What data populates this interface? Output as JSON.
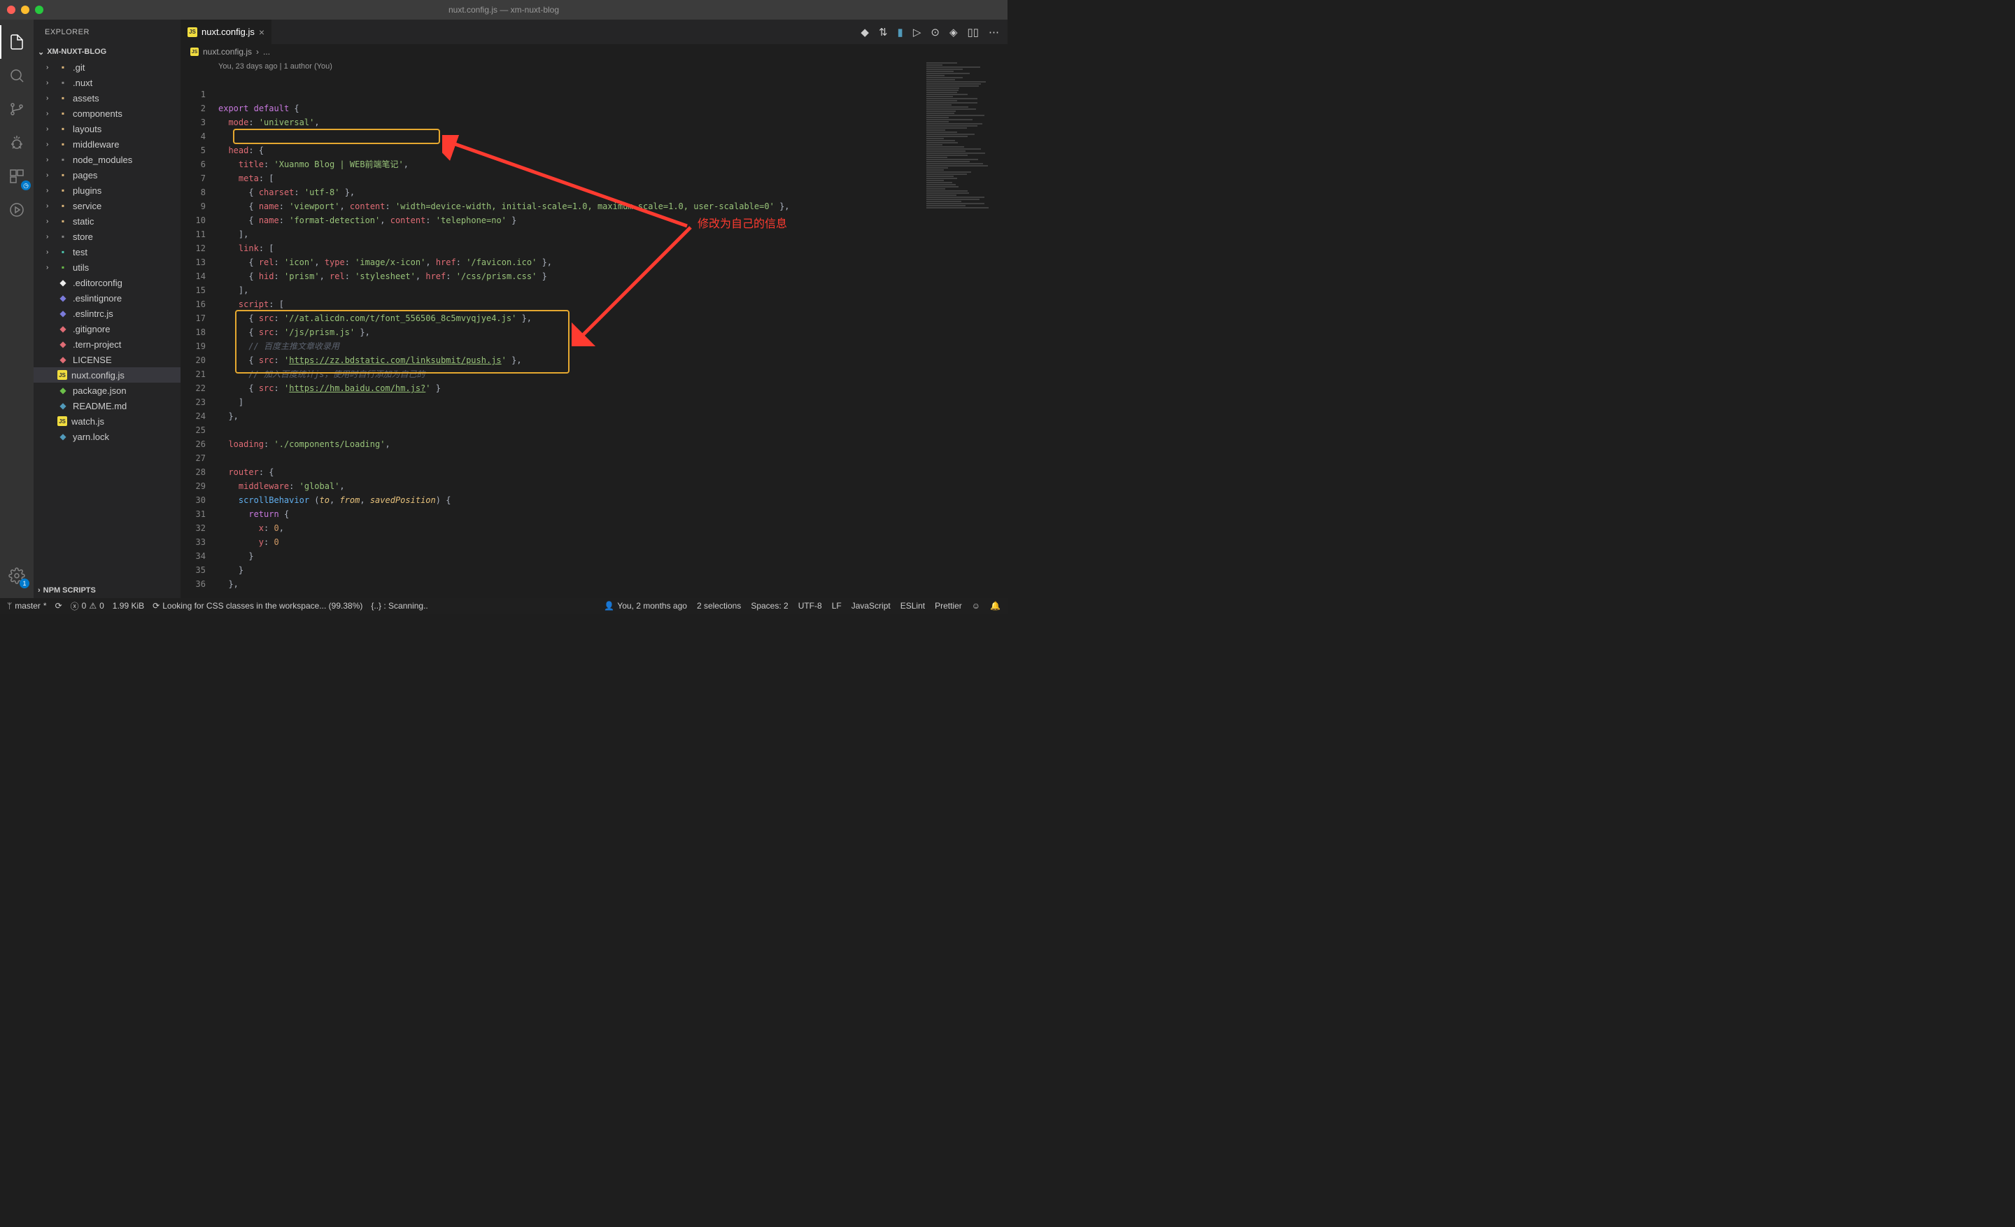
{
  "titlebar": {
    "title": "nuxt.config.js — xm-nuxt-blog"
  },
  "explorer": {
    "title": "EXPLORER",
    "project": "XM-NUXT-BLOG",
    "npm_scripts": "NPM SCRIPTS",
    "folders": [
      {
        "name": ".git",
        "type": "folder",
        "color": "folder-icon"
      },
      {
        "name": ".nuxt",
        "type": "folder",
        "color": "folder-icon grey"
      },
      {
        "name": "assets",
        "type": "folder",
        "color": "folder-icon"
      },
      {
        "name": "components",
        "type": "folder",
        "color": "folder-icon"
      },
      {
        "name": "layouts",
        "type": "folder",
        "color": "folder-icon"
      },
      {
        "name": "middleware",
        "type": "folder",
        "color": "folder-icon"
      },
      {
        "name": "node_modules",
        "type": "folder",
        "color": "folder-icon grey"
      },
      {
        "name": "pages",
        "type": "folder",
        "color": "folder-icon"
      },
      {
        "name": "plugins",
        "type": "folder",
        "color": "folder-icon"
      },
      {
        "name": "service",
        "type": "folder",
        "color": "folder-icon"
      },
      {
        "name": "static",
        "type": "folder",
        "color": "folder-icon"
      },
      {
        "name": "store",
        "type": "folder",
        "color": "folder-icon grey"
      },
      {
        "name": "test",
        "type": "folder",
        "color": "folder-icon teal"
      },
      {
        "name": "utils",
        "type": "folder",
        "color": "folder-icon green"
      }
    ],
    "files": [
      {
        "name": ".editorconfig",
        "iconcolor": "#eee"
      },
      {
        "name": ".eslintignore",
        "iconcolor": "#7b7bdb"
      },
      {
        "name": ".eslintrc.js",
        "iconcolor": "#7b7bdb"
      },
      {
        "name": ".gitignore",
        "iconcolor": "#e06c75"
      },
      {
        "name": ".tern-project",
        "iconcolor": "#e06c75"
      },
      {
        "name": "LICENSE",
        "iconcolor": "#e06c75"
      },
      {
        "name": "nuxt.config.js",
        "iconcolor": "js",
        "selected": true
      },
      {
        "name": "package.json",
        "iconcolor": "#6cc04a"
      },
      {
        "name": "README.md",
        "iconcolor": "#519aba"
      },
      {
        "name": "watch.js",
        "iconcolor": "js"
      },
      {
        "name": "yarn.lock",
        "iconcolor": "#519aba"
      }
    ]
  },
  "tab": {
    "label": "nuxt.config.js"
  },
  "breadcrumb": {
    "file": "nuxt.config.js",
    "more": "..."
  },
  "codelens": "You, 23 days ago | 1 author (You)",
  "code_lines": [
    "<span class='k-keyword'>export</span> <span class='k-keyword'>default</span> <span class='k-punc'>{</span>",
    "  <span class='k-prop'>mode</span><span class='k-punc'>:</span> <span class='k-string'>'universal'</span><span class='k-punc'>,</span>",
    "",
    "  <span class='k-prop'>head</span><span class='k-punc'>: {</span>",
    "    <span class='k-prop'>title</span><span class='k-punc'>:</span> <span class='k-string'>'Xuanmo Blog | WEB前端笔记'</span><span class='k-punc'>,</span>",
    "    <span class='k-prop'>meta</span><span class='k-punc'>: [</span>",
    "      <span class='k-punc'>{</span> <span class='k-prop'>charset</span><span class='k-punc'>:</span> <span class='k-string'>'utf-8'</span> <span class='k-punc'>},</span>",
    "      <span class='k-punc'>{</span> <span class='k-prop'>name</span><span class='k-punc'>:</span> <span class='k-string'>'viewport'</span><span class='k-punc'>,</span> <span class='k-prop'>content</span><span class='k-punc'>:</span> <span class='k-string'>'width=device-width, initial-scale=1.0, maximum-scale=1.0, user-scalable=0'</span> <span class='k-punc'>},</span>",
    "      <span class='k-punc'>{</span> <span class='k-prop'>name</span><span class='k-punc'>:</span> <span class='k-string'>'format-detection'</span><span class='k-punc'>,</span> <span class='k-prop'>content</span><span class='k-punc'>:</span> <span class='k-string'>'telephone=no'</span> <span class='k-punc'>}</span>",
    "    <span class='k-punc'>],</span>",
    "    <span class='k-prop'>link</span><span class='k-punc'>: [</span>",
    "      <span class='k-punc'>{</span> <span class='k-prop'>rel</span><span class='k-punc'>:</span> <span class='k-string'>'icon'</span><span class='k-punc'>,</span> <span class='k-prop'>type</span><span class='k-punc'>:</span> <span class='k-string'>'image/x-icon'</span><span class='k-punc'>,</span> <span class='k-prop'>href</span><span class='k-punc'>:</span> <span class='k-string'>'/favicon.ico'</span> <span class='k-punc'>},</span>",
    "      <span class='k-punc'>{</span> <span class='k-prop'>hid</span><span class='k-punc'>:</span> <span class='k-string'>'prism'</span><span class='k-punc'>,</span> <span class='k-prop'>rel</span><span class='k-punc'>:</span> <span class='k-string'>'stylesheet'</span><span class='k-punc'>,</span> <span class='k-prop'>href</span><span class='k-punc'>:</span> <span class='k-string'>'/css/prism.css'</span> <span class='k-punc'>}</span>",
    "    <span class='k-punc'>],</span>",
    "    <span class='k-prop'>script</span><span class='k-punc'>: [</span>",
    "      <span class='k-punc'>{</span> <span class='k-prop'>src</span><span class='k-punc'>:</span> <span class='k-string'>'//at.alicdn.com/t/font_556506_8c5mvyqjye4.js'</span> <span class='k-punc'>},</span>",
    "      <span class='k-punc'>{</span> <span class='k-prop'>src</span><span class='k-punc'>:</span> <span class='k-string'>'/js/prism.js'</span> <span class='k-punc'>},</span>",
    "      <span class='k-comment'>// 百度主推文章收录用</span>",
    "      <span class='k-punc'>{</span> <span class='k-prop'>src</span><span class='k-punc'>:</span> <span class='k-string'>'</span><span class='k-link'>https://zz.bdstatic.com/linksubmit/push.js</span><span class='k-string'>'</span> <span class='k-punc'>},</span>",
    "      <span class='k-comment'>// 加入百度统计js，使用时自行添加为自己的</span>",
    "      <span class='k-punc'>{</span> <span class='k-prop'>src</span><span class='k-punc'>:</span> <span class='k-string'>'</span><span class='k-link'>https://hm.baidu.com/hm.js?</span><span class='k-string'>'</span> <span class='k-punc'>}</span>",
    "    <span class='k-punc'>]</span>",
    "  <span class='k-punc'>},</span>",
    "",
    "  <span class='k-prop'>loading</span><span class='k-punc'>:</span> <span class='k-string'>'./components/Loading'</span><span class='k-punc'>,</span>",
    "",
    "  <span class='k-prop'>router</span><span class='k-punc'>: {</span>",
    "    <span class='k-prop'>middleware</span><span class='k-punc'>:</span> <span class='k-string'>'global'</span><span class='k-punc'>,</span>",
    "    <span class='k-func'>scrollBehavior</span> <span class='k-punc'>(</span><span class='k-param'>to</span><span class='k-punc'>,</span> <span class='k-param'>from</span><span class='k-punc'>,</span> <span class='k-param'>savedPosition</span><span class='k-punc'>) {</span>",
    "      <span class='k-keyword'>return</span> <span class='k-punc'>{</span>",
    "        <span class='k-prop'>x</span><span class='k-punc'>:</span> <span class='k-num'>0</span><span class='k-punc'>,</span>",
    "        <span class='k-prop'>y</span><span class='k-punc'>:</span> <span class='k-num'>0</span>",
    "      <span class='k-punc'>}</span>",
    "    <span class='k-punc'>}</span>",
    "  <span class='k-punc'>},</span>",
    ""
  ],
  "annotation_text": "修改为自己的信息",
  "statusbar": {
    "branch": "master",
    "sync": "",
    "errors": "0",
    "warnings": "0",
    "size": "1.99 KiB",
    "css_scan": "Looking for CSS classes in the workspace... (99.38%)",
    "scanning": "{..} : Scanning..",
    "blame": "You, 2 months ago",
    "selections": "2 selections",
    "spaces": "Spaces: 2",
    "encoding": "UTF-8",
    "eol": "LF",
    "lang": "JavaScript",
    "eslint": "ESLint",
    "prettier": "Prettier"
  }
}
